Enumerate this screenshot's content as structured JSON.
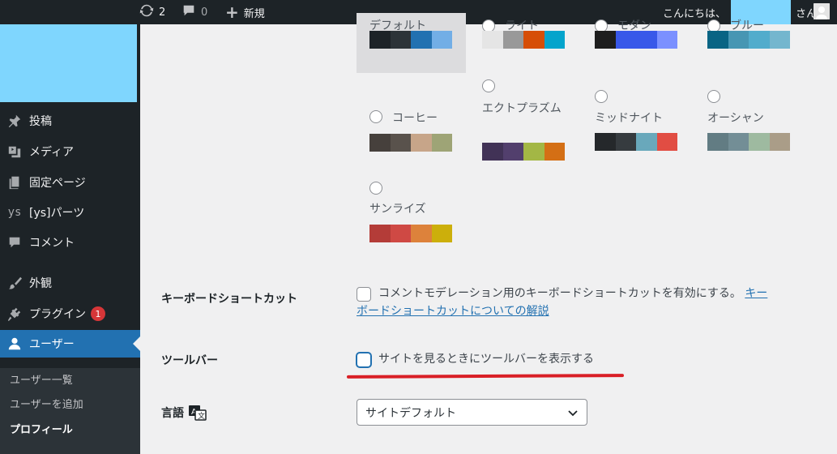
{
  "adminbar": {
    "updates_count": "2",
    "comments_count": "0",
    "new_label": "新規",
    "greeting_prefix": "こんにちは、",
    "greeting_suffix": "さん"
  },
  "sidebar": {
    "items": [
      {
        "label": "投稿",
        "icon": "pin-icon"
      },
      {
        "label": "メディア",
        "icon": "media-icon"
      },
      {
        "label": "固定ページ",
        "icon": "page-icon"
      },
      {
        "label": "[ys]パーツ",
        "icon": "ys-icon"
      },
      {
        "label": "コメント",
        "icon": "comment-icon"
      },
      {
        "label": "外観",
        "icon": "brush-icon"
      },
      {
        "label": "プラグイン",
        "icon": "plugin-icon",
        "badge": "1"
      },
      {
        "label": "ユーザー",
        "icon": "user-icon"
      }
    ],
    "submenu": [
      {
        "label": "ユーザー一覧"
      },
      {
        "label": "ユーザーを追加"
      },
      {
        "label": "プロフィール"
      }
    ]
  },
  "color_schemes": [
    {
      "name": "デフォルト",
      "colors": [
        "#1d2327",
        "#2c3338",
        "#2271b1",
        "#72aee6"
      ]
    },
    {
      "name": "ライト",
      "colors": [
        "#e5e5e5",
        "#999999",
        "#d64e07",
        "#04a4cc"
      ]
    },
    {
      "name": "モダン",
      "colors": [
        "#1e1e1e",
        "#3858e9",
        "#3858e9",
        "#7b90ff"
      ]
    },
    {
      "name": "ブルー",
      "colors": [
        "#096484",
        "#4796b3",
        "#52accc",
        "#74b6ce"
      ]
    },
    {
      "name": "コーヒー",
      "colors": [
        "#46403c",
        "#59524c",
        "#c7a589",
        "#9ea476"
      ]
    },
    {
      "name": "エクトプラズム",
      "colors": [
        "#413256",
        "#523f6d",
        "#a3b745",
        "#d46f15"
      ]
    },
    {
      "name": "ミッドナイト",
      "colors": [
        "#25282b",
        "#363b3f",
        "#69a8bb",
        "#e14d43"
      ]
    },
    {
      "name": "オーシャン",
      "colors": [
        "#627c83",
        "#738e96",
        "#9ebaa0",
        "#aa9d88"
      ]
    },
    {
      "name": "サンライズ",
      "colors": [
        "#b43c38",
        "#cf4944",
        "#dd823b",
        "#ccaf0b"
      ]
    }
  ],
  "keyboard_shortcuts": {
    "label": "キーボードショートカット",
    "text": "コメントモデレーション用のキーボードショートカットを有効にする。",
    "link_line1": "キー",
    "link_line2": "ボードショートカットについての解説"
  },
  "toolbar": {
    "label": "ツールバー",
    "text": "サイトを見るときにツールバーを表示する"
  },
  "language": {
    "label": "言語",
    "selected": "サイトデフォルト"
  }
}
